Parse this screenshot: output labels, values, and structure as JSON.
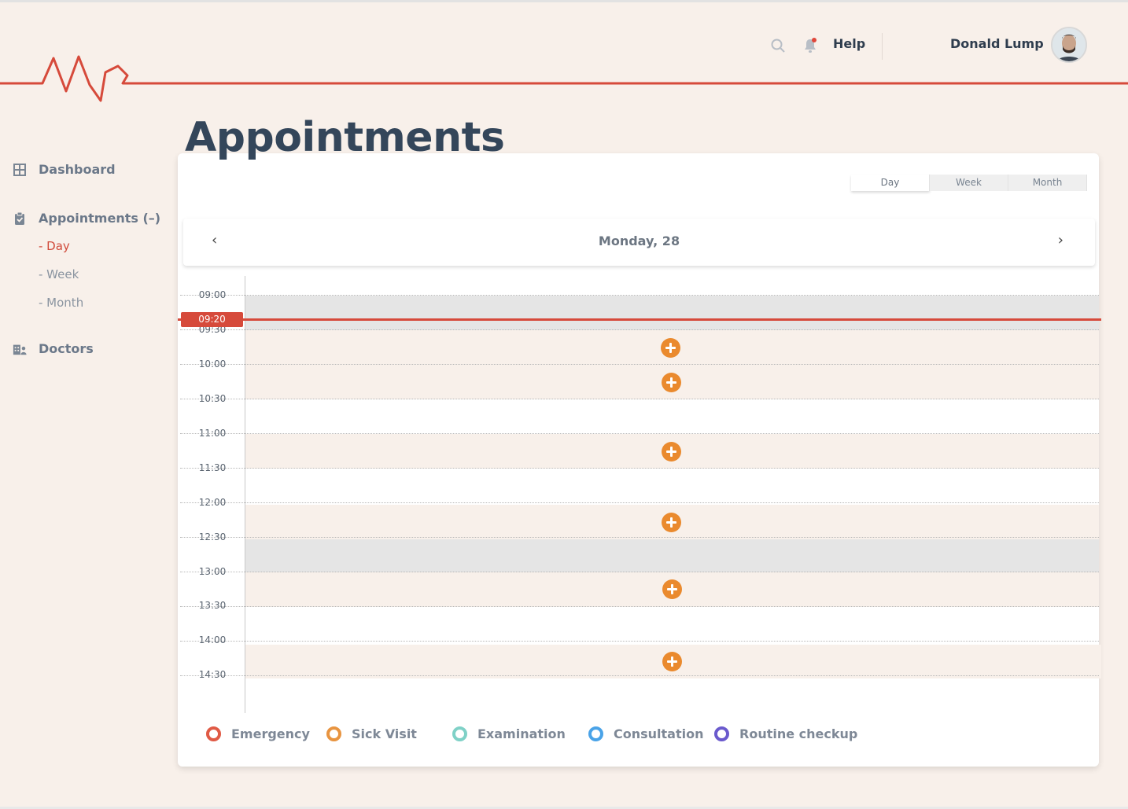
{
  "header": {
    "help_label": "Help",
    "user_name": "Donald Lump",
    "notification_dot_color": "#e0463a"
  },
  "sidebar": {
    "items": [
      {
        "label": "Dashboard",
        "icon": "grid-icon"
      },
      {
        "label": "Appointments (–)",
        "icon": "clipboard-check-icon",
        "children": [
          {
            "label": "- Day",
            "active": true
          },
          {
            "label": "- Week"
          },
          {
            "label": "- Month"
          }
        ]
      },
      {
        "label": "Doctors",
        "icon": "doctors-building-icon"
      }
    ]
  },
  "page": {
    "title": "Appointments"
  },
  "calendar": {
    "views": [
      "Day",
      "Week",
      "Month"
    ],
    "active_view": "Day",
    "current_date": "Monday, 28",
    "prev_symbol": "‹",
    "next_symbol": "›",
    "current_time": "09:20",
    "time_slots": [
      "09:00",
      "09:30",
      "10:00",
      "10:30",
      "11:00",
      "11:30",
      "12:00",
      "12:30",
      "13:00",
      "13:30",
      "14:00",
      "14:30"
    ]
  },
  "legend": [
    {
      "label": "Emergency",
      "color": "#e05a45"
    },
    {
      "label": "Sick Visit",
      "color": "#e89440"
    },
    {
      "label": "Examination",
      "color": "#7fd1c7"
    },
    {
      "label": "Consultation",
      "color": "#4aa3e8"
    },
    {
      "label": "Routine checkup",
      "color": "#6a5acd"
    }
  ],
  "colors": {
    "accent": "#d64a3b",
    "add_button": "#ea8a2e",
    "title": "#34465a"
  }
}
